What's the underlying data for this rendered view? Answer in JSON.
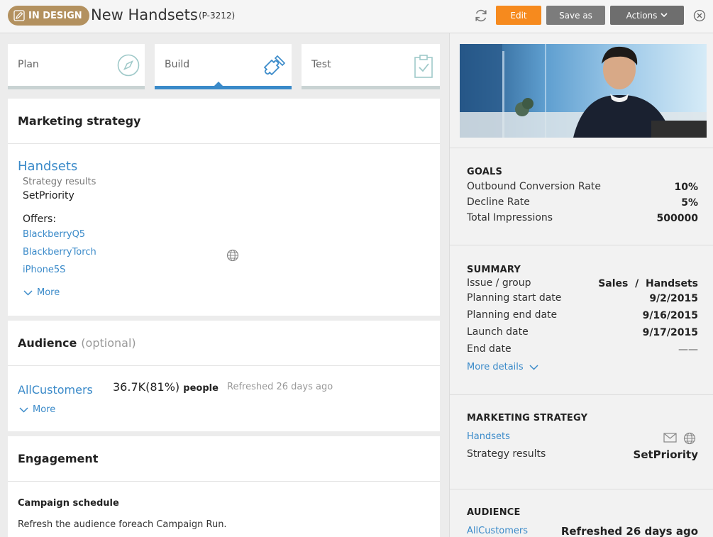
{
  "header": {
    "status": "IN DESIGN",
    "title": "New Handsets",
    "id": "(P-3212)",
    "edit_label": "Edit",
    "saveas_label": "Save as",
    "actions_label": "Actions"
  },
  "stages": [
    {
      "label": "Plan",
      "icon": "compass-icon",
      "active": false
    },
    {
      "label": "Build",
      "icon": "puzzle-icon",
      "active": true
    },
    {
      "label": "Test",
      "icon": "clipboard-check-icon",
      "active": false
    }
  ],
  "marketing": {
    "heading": "Marketing strategy",
    "strategy_name": "Handsets",
    "results_label": "Strategy results",
    "results_value": "SetPriority",
    "offers_label": "Offers:",
    "offers": [
      "BlackberryQ5",
      "BlackberryTorch",
      "iPhone5S"
    ],
    "more_label": "More"
  },
  "audience": {
    "heading": "Audience",
    "optional": "(optional)",
    "name": "AllCustomers",
    "count": "36.7K",
    "percent": "(81%)",
    "unit": "people",
    "refreshed_label": "Refreshed",
    "refreshed_value": "26 days ago",
    "more_label": "More"
  },
  "engagement": {
    "heading": "Engagement",
    "schedule_title": "Campaign schedule",
    "schedule_text": "Refresh the audience foreach Campaign Run."
  },
  "goals": {
    "title": "GOALS",
    "rows": [
      {
        "label": "Outbound Conversion Rate",
        "value": "10%"
      },
      {
        "label": "Decline Rate",
        "value": "5%"
      },
      {
        "label": "Total Impressions",
        "value": "500000"
      }
    ]
  },
  "summary": {
    "title": "SUMMARY",
    "rows": [
      {
        "label": "Issue / group",
        "value": "Sales  /  Handsets"
      },
      {
        "label": "Planning start date",
        "value": "9/2/2015"
      },
      {
        "label": "Planning end date",
        "value": "9/16/2015"
      },
      {
        "label": "Launch date",
        "value": "9/17/2015"
      },
      {
        "label": "End date",
        "value": "——"
      }
    ],
    "more_label": "More details"
  },
  "side_strategy": {
    "title": "MARKETING STRATEGY",
    "name": "Handsets",
    "results_label": "Strategy results",
    "results_value": "SetPriority"
  },
  "side_audience": {
    "title": "AUDIENCE",
    "name": "AllCustomers",
    "refreshed_label": "Refreshed",
    "refreshed_value": "26 days ago"
  },
  "colors": {
    "accent": "#3a8ac9",
    "status_pill": "#b3915f",
    "edit_button": "#f68a1e"
  }
}
